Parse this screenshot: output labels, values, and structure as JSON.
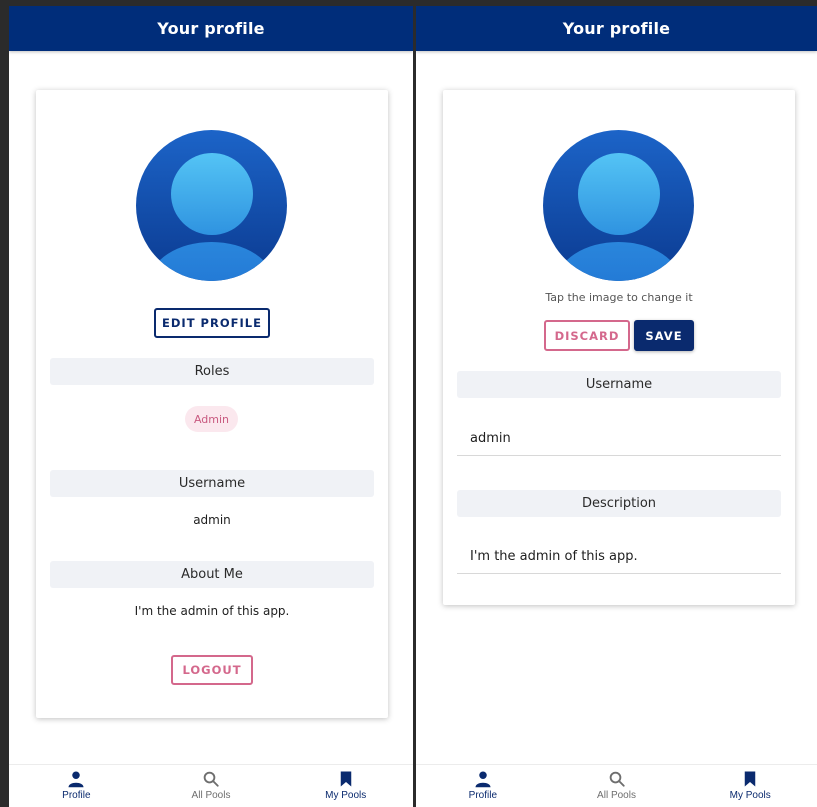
{
  "left": {
    "header_title": "Your profile",
    "edit_button": "EDIT PROFILE",
    "roles_title": "Roles",
    "role_chip": "Admin",
    "username_title": "Username",
    "username_value": "admin",
    "about_title": "About Me",
    "about_value": "I'm the admin of this app.",
    "logout_button": "LOGOUT"
  },
  "right": {
    "header_title": "Your profile",
    "hint": "Tap the image to change it",
    "discard_button": "DISCARD",
    "save_button": "SAVE",
    "username_title": "Username",
    "username_value": "admin",
    "description_title": "Description",
    "description_value": "I'm the admin of this app."
  },
  "nav": {
    "profile": "Profile",
    "all_pools": "All Pools",
    "my_pools": "My Pools"
  },
  "colors": {
    "header": "#002d7a",
    "navy": "#0a2a6e",
    "pink": "#d4688c"
  }
}
